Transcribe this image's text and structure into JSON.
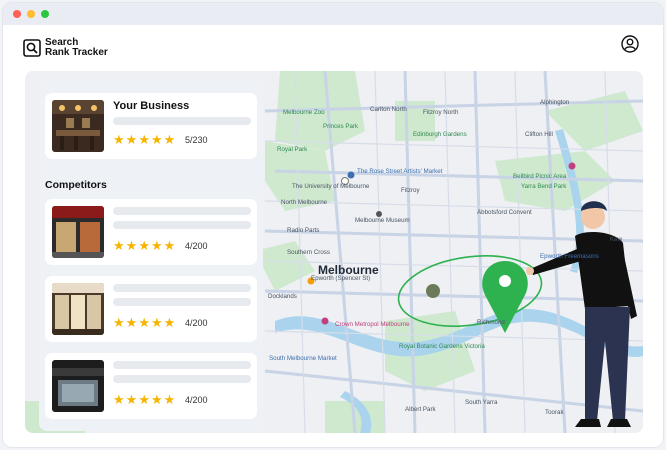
{
  "window": {
    "dots": [
      "#ff5f57",
      "#febc2e",
      "#28c840"
    ]
  },
  "app": {
    "logo_line1": "Search",
    "logo_line2": "Rank Tracker"
  },
  "header": {
    "icons": [
      "magnifier-logo-icon",
      "user-account-icon"
    ]
  },
  "your_business": {
    "title": "Your Business",
    "rating": 5,
    "score": "5/230"
  },
  "competitors_heading": "Competitors",
  "competitors": [
    {
      "rating": 5,
      "score": "4/200"
    },
    {
      "rating": 5,
      "score": "4/200"
    },
    {
      "rating": 5,
      "score": "4/200"
    }
  ],
  "map": {
    "city": "Melbourne",
    "labels": {
      "carlton_north": "Carlton North",
      "fitzroy_north": "Fitzroy North",
      "zoo": "Melbourne Zoo",
      "princes_park": "Princes Park",
      "edinburgh_gardens": "Edinburgh Gardens",
      "royal_park": "Royal Park",
      "rose_street": "The Rose Street Artists' Market",
      "fitzroy": "Fitzroy",
      "university": "The University of Melbourne",
      "museum": "Melbourne Museum",
      "north_melbourne": "North Melbourne",
      "radio_parts": "Radio Parts",
      "clifton_hill": "Clifton Hill",
      "alphington": "Alphington",
      "bellbird": "Bellbird Picnic Area",
      "yarra_bend": "Yarra Bend Park",
      "abbotsford": "Abbotsford Convent",
      "epworth": "Epworth Freemasons",
      "kew": "Kew",
      "docklands": "Docklands",
      "southern_cross": "Southern Cross",
      "epworth_city": "Epworth (Spencer St)",
      "crown": "Crown Metropol Melbourne",
      "richmond": "Richmond",
      "south_wharf": "South Melbourne Market",
      "botanic": "Royal Botanic Gardens Victoria",
      "south_yarra": "South Yarra",
      "toorak": "Toorak",
      "albert_park": "Albert Park"
    },
    "colors": {
      "park": "#cfe9cf",
      "road": "#c8d3e6",
      "water": "#aad3ee",
      "pin": "#2eb24f"
    }
  }
}
